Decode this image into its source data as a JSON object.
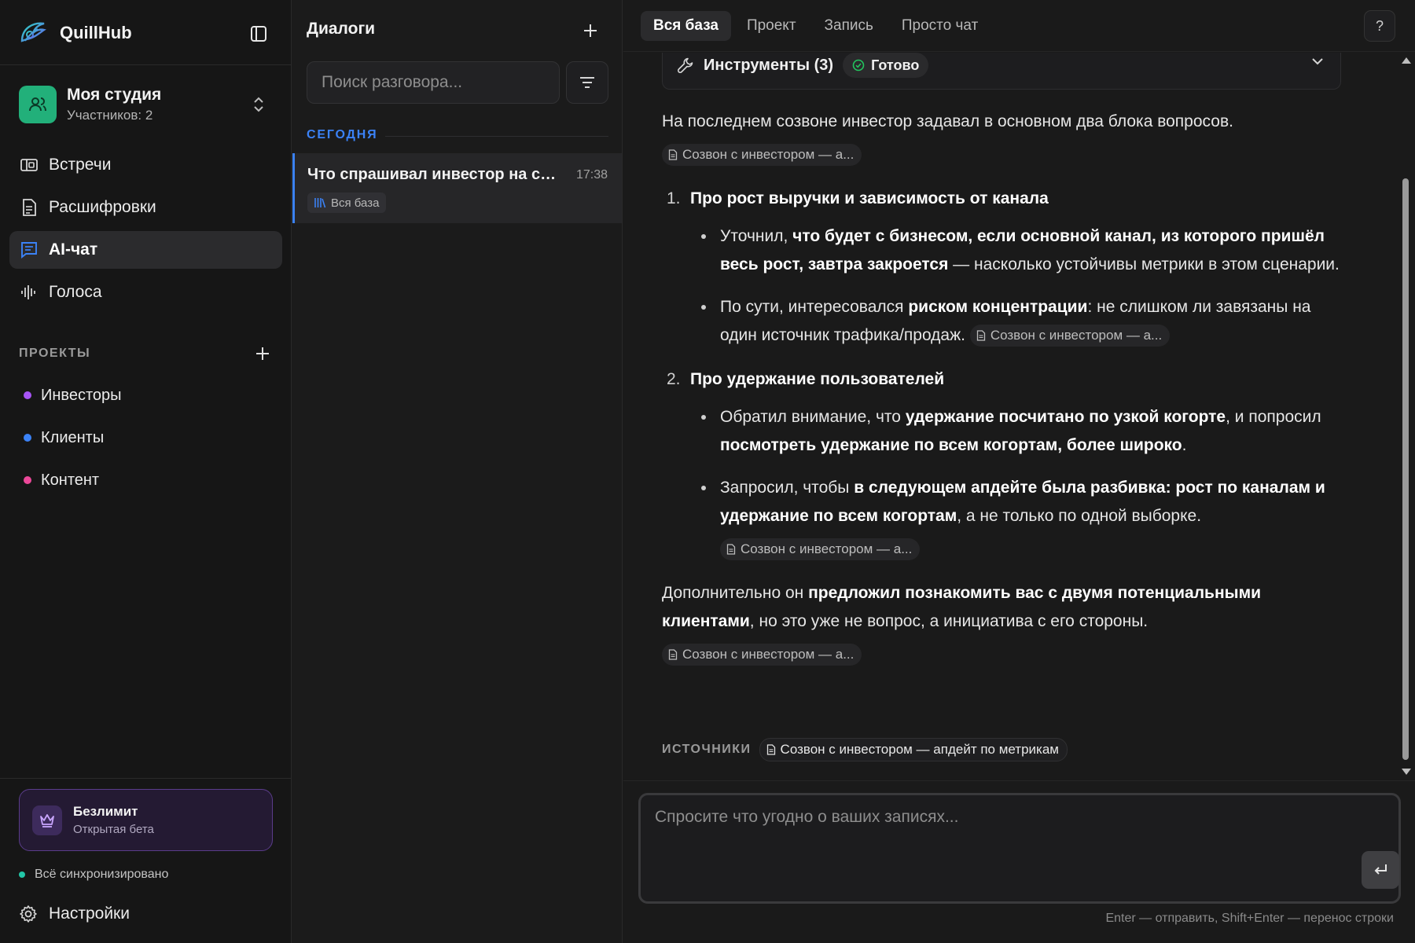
{
  "app": {
    "name": "QuillHub"
  },
  "workspace": {
    "name": "Моя студия",
    "members": "Участников: 2"
  },
  "nav": {
    "items": [
      {
        "label": "Встречи",
        "icon": "meetings-icon"
      },
      {
        "label": "Расшифровки",
        "icon": "transcripts-icon"
      },
      {
        "label": "AI-чат",
        "icon": "chat-icon",
        "active": true
      },
      {
        "label": "Голоса",
        "icon": "voices-icon"
      }
    ]
  },
  "projects": {
    "title": "ПРОЕКТЫ",
    "items": [
      {
        "label": "Инвесторы",
        "color": "#a855f7"
      },
      {
        "label": "Клиенты",
        "color": "#3b82f6"
      },
      {
        "label": "Контент",
        "color": "#ec4899"
      }
    ]
  },
  "plan": {
    "title": "Безлимит",
    "subtitle": "Открытая бета"
  },
  "sync": {
    "label": "Всё синхронизировано"
  },
  "settings": {
    "label": "Настройки"
  },
  "dialogs": {
    "title": "Диалоги",
    "search_placeholder": "Поиск разговора...",
    "group_label": "СЕГОДНЯ",
    "conversation": {
      "title": "Что спрашивал инвестор на созвоне",
      "time": "17:38",
      "badge": "Вся база"
    }
  },
  "tabs": [
    {
      "label": "Вся база",
      "active": true
    },
    {
      "label": "Проект"
    },
    {
      "label": "Запись"
    },
    {
      "label": "Просто чат"
    }
  ],
  "help_label": "?",
  "tools": {
    "label": "Инструменты (3)",
    "status": "Готово"
  },
  "message": {
    "intro": "На последнем созвоне инвестор задавал в основном два блока вопросов.",
    "chip_short": "Созвон с инвестором — а...",
    "section1": {
      "num": "1.",
      "head": "Про рост выручки и зависимость от канала",
      "b1": {
        "t1": "Уточнил, ",
        "b": "что будет с бизнесом, если основной канал, из которого пришёл весь рост, завтра закроется",
        "t2": " — насколько устойчивы метрики в этом сценарии."
      },
      "b2": {
        "t1": "По сути, интересовался ",
        "b": "риском концентрации",
        "t2": ": не слишком ли завязаны на один источник трафика/продаж."
      }
    },
    "section2": {
      "num": "2.",
      "head": "Про удержание пользователей",
      "b1": {
        "t1": "Обратил внимание, что ",
        "b1": "удержание посчитано по узкой когорте",
        "t2": ", и попросил ",
        "b2": "посмотреть удержание по всем когортам, более широко",
        "t3": "."
      },
      "b2": {
        "t1": "Запросил, чтобы ",
        "b": "в следующем апдейте была разбивка: рост по каналам и удержание по всем когортам",
        "t2": ", а не только по одной выборке."
      }
    },
    "outro": {
      "t1": "Дополнительно он ",
      "b": "предложил познакомить вас с двумя потенциальными клиентами",
      "t2": ", но это уже не вопрос, а инициатива с его стороны."
    }
  },
  "sources": {
    "label": "ИСТОЧНИКИ",
    "item": "Созвон с инвестором — апдейт по метрикам"
  },
  "composer": {
    "placeholder": "Спросите что угодно о ваших записях...",
    "hint": "Enter — отправить, Shift+Enter — перенос строки"
  },
  "colors": {
    "accent": "#3b82f6",
    "workspace_avatar": "#22b07a",
    "status_ok": "#22c55e",
    "sync_dot": "#22c7a8",
    "plan_border": "#5a3c8a"
  }
}
